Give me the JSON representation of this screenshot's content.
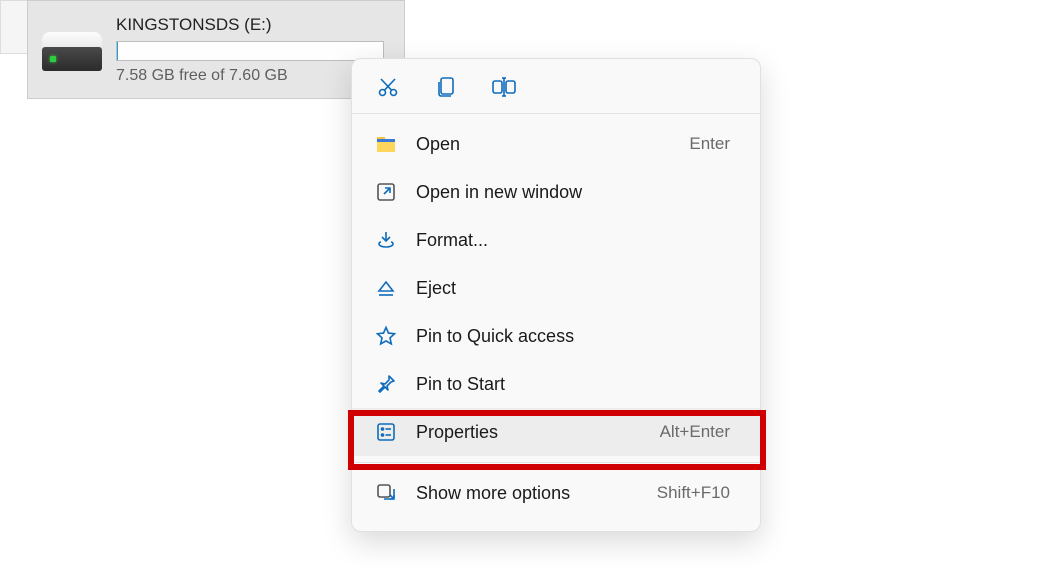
{
  "drive": {
    "name": "KINGSTONSDS (E:)",
    "free_text": "7.58 GB free of 7.60 GB"
  },
  "toolbar": {
    "cut": "cut",
    "copy": "copy",
    "rename": "rename"
  },
  "menu": {
    "open": {
      "label": "Open",
      "shortcut": "Enter"
    },
    "open_new_window": {
      "label": "Open in new window"
    },
    "format": {
      "label": "Format..."
    },
    "eject": {
      "label": "Eject"
    },
    "pin_quick": {
      "label": "Pin to Quick access"
    },
    "pin_start": {
      "label": "Pin to Start"
    },
    "properties": {
      "label": "Properties",
      "shortcut": "Alt+Enter"
    },
    "show_more": {
      "label": "Show more options",
      "shortcut": "Shift+F10"
    }
  }
}
